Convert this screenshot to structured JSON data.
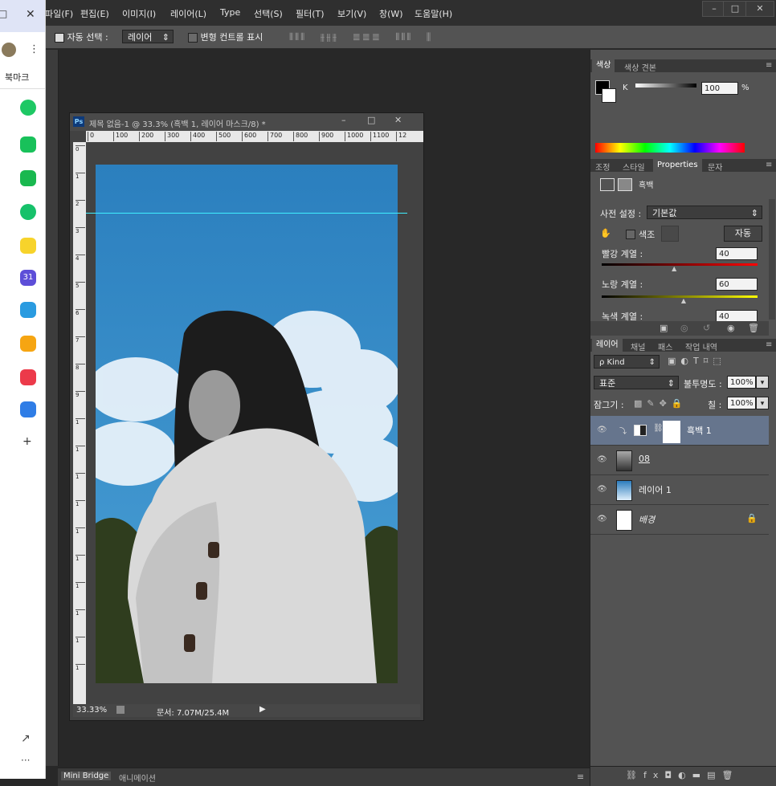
{
  "menu": [
    "파일(F)",
    "편집(E)",
    "이미지(I)",
    "레이어(L)",
    "Type",
    "선택(S)",
    "필터(T)",
    "보기(V)",
    "창(W)",
    "도움말(H)"
  ],
  "window_controls": {
    "minimize": "–",
    "maximize": "□",
    "close": "✕"
  },
  "options_bar": {
    "auto_select_label": "자동 선택 :",
    "auto_select_value": "레이어",
    "transform_label": "변형 컨트롤 표시"
  },
  "browser_panel": {
    "bookmark_label": "북마크",
    "calendar_label": "31",
    "add_label": "+",
    "more_label": "···"
  },
  "document": {
    "title": "제목 없음-1 @ 33.3% (흑백 1, 레이어 마스크/8) *",
    "zoom": "33.33%",
    "doc_info": "문서: 7.07M/25.4M",
    "ruler_top": [
      "0",
      "100",
      "200",
      "300",
      "400",
      "500",
      "600",
      "700",
      "800",
      "900",
      "1000",
      "1100",
      "12"
    ],
    "ruler_left": [
      "0",
      "1",
      "2",
      "3",
      "4",
      "5",
      "6",
      "7",
      "8",
      "9",
      "1",
      "1",
      "1",
      "1",
      "1",
      "1",
      "1",
      "1",
      "1",
      "1"
    ]
  },
  "color_panel": {
    "tabs": [
      "색상",
      "색상 견본"
    ],
    "channel": "K",
    "value": "100",
    "unit": "%"
  },
  "properties_panel": {
    "tabs": [
      "조정",
      "스타일",
      "Properties",
      "문자"
    ],
    "adjustment_name": "흑백",
    "preset_label": "사전 설정 :",
    "preset_value": "기본값",
    "tint_label": "색조",
    "auto_button": "자동",
    "sliders": [
      {
        "label": "빨강 계열 :",
        "value": "40",
        "fraction": 0.47
      },
      {
        "label": "노랑 계열 :",
        "value": "60",
        "fraction": 0.53
      },
      {
        "label": "녹색 계열 :",
        "value": "40"
      }
    ]
  },
  "layers_panel": {
    "tabs": [
      "레이어",
      "채널",
      "패스",
      "작업 내역"
    ],
    "filter_kind": "ρ Kind",
    "blend_mode": "표준",
    "opacity_label": "불투명도 :",
    "opacity_value": "100%",
    "lock_label": "잠그기 :",
    "fill_label": "칠 :",
    "fill_value": "100%",
    "layers": [
      {
        "name": "흑백 1",
        "selected": true
      },
      {
        "name": "08",
        "selected": false
      },
      {
        "name": "레이어 1",
        "selected": false
      },
      {
        "name": "배경",
        "selected": false
      }
    ]
  },
  "bottom_bar": {
    "mini_bridge": "Mini Bridge",
    "animation": "애니메이션"
  },
  "colors": {
    "accent": "#2f86c5",
    "selected_layer": "#6d7d96",
    "panel": "#535353"
  }
}
